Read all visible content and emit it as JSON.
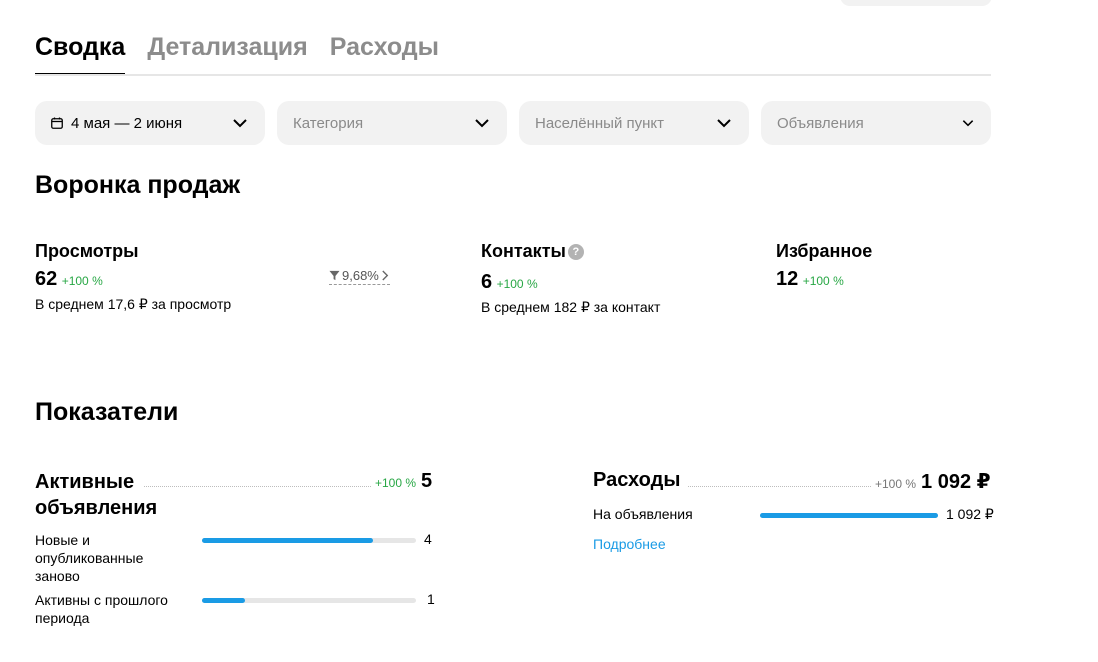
{
  "tabs": [
    {
      "label": "Сводка",
      "active": true
    },
    {
      "label": "Детализация",
      "active": false
    },
    {
      "label": "Расходы",
      "active": false
    }
  ],
  "filters": {
    "date": "4 мая — 2 июня",
    "category": "Категория",
    "city": "Населённый пункт",
    "ads": "Объявления"
  },
  "funnel": {
    "title": "Воронка продаж",
    "views": {
      "label": "Просмотры",
      "value": "62",
      "change": "+100 %",
      "avg": "В среднем 17,6 ₽ за просмотр"
    },
    "conversion": "9,68%",
    "contacts": {
      "label": "Контакты",
      "help": "?",
      "value": "6",
      "change": "+100 %",
      "avg": "В среднем 182 ₽ за контакт"
    },
    "favorites": {
      "label": "Избранное",
      "value": "12",
      "change": "+100 %"
    }
  },
  "indicators": {
    "title": "Показатели",
    "active_ads": {
      "label_line1": "Активные",
      "label_line2": "объявления",
      "change": "+100 %",
      "value": "5",
      "rows": [
        {
          "label": "Новые и опубликованные заново",
          "value": "4",
          "fill": 0.8
        },
        {
          "label": "Активны с прошлого периода",
          "value": "1",
          "fill": 0.2
        }
      ]
    },
    "expenses": {
      "label": "Расходы",
      "change": "+100 %",
      "value": "1 092 ₽",
      "rows": [
        {
          "label": "На объявления",
          "value": "1 092 ₽",
          "fill": 1.0
        }
      ],
      "more": "Подробнее"
    }
  },
  "colors": {
    "accent": "#1a9be5",
    "positive": "#28a745",
    "filter_bg": "#f2f2f2"
  }
}
